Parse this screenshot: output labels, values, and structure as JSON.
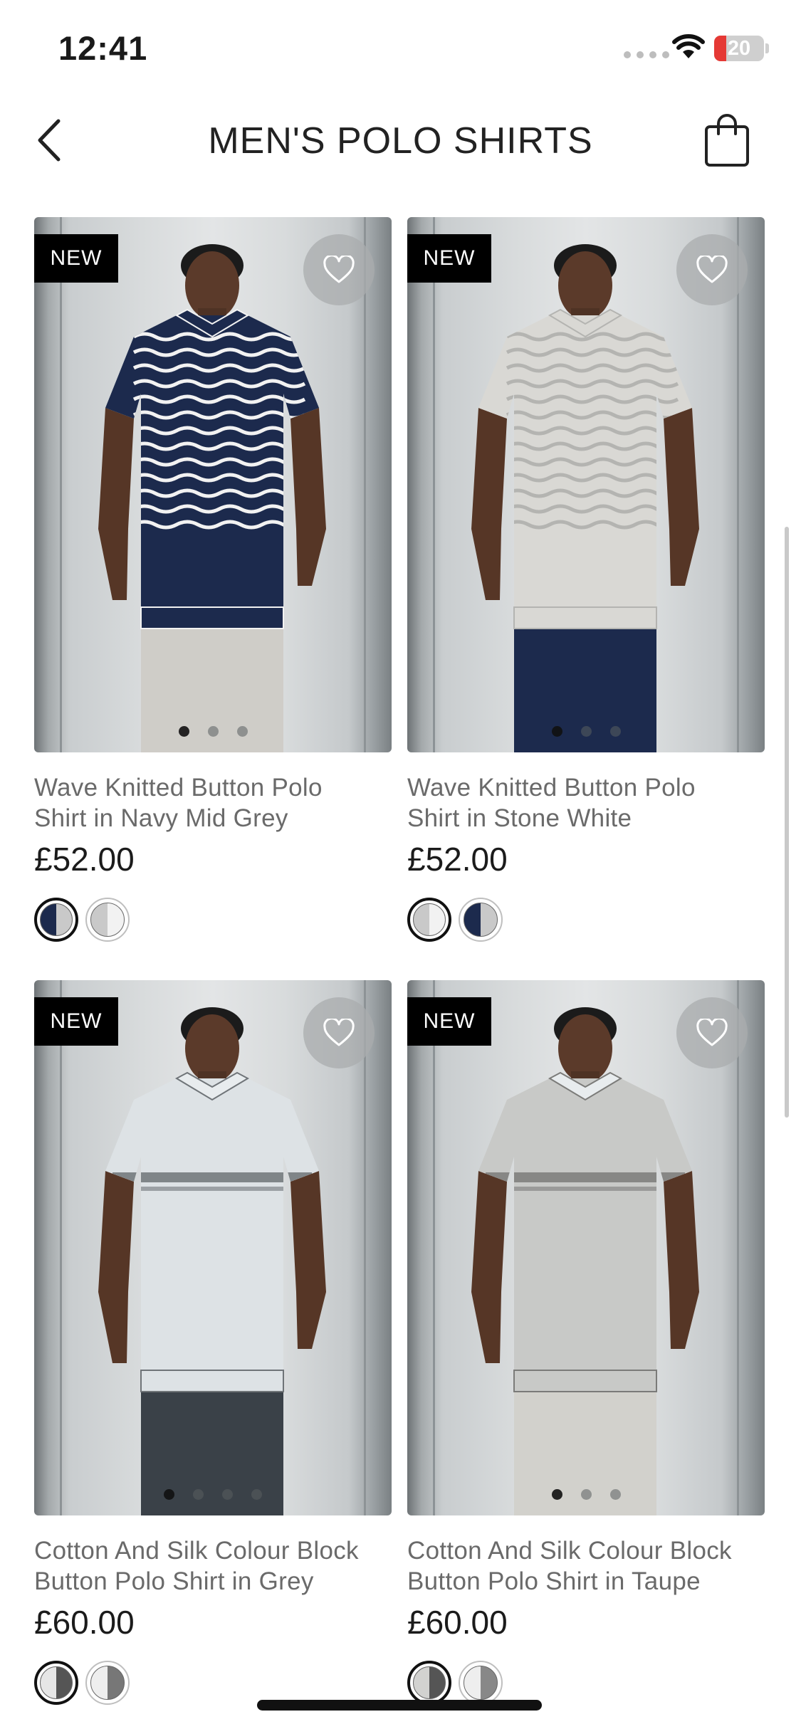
{
  "status_bar": {
    "time": "12:41",
    "battery": "20"
  },
  "header": {
    "title": "MEN'S POLO SHIRTS"
  },
  "products": [
    {
      "badge": "NEW",
      "name_line1": "Wave Knitted Button Polo",
      "name_line2": "Shirt in Navy Mid Grey",
      "price": "£52.00",
      "shirt_color": "#1c2a4d",
      "stripe_color": "#f2f2f2",
      "pants_color": "#cfcdc8",
      "image_dots": 3,
      "active_dot": 0,
      "swatches": [
        {
          "colors": [
            "#1c2a4d",
            "#c9c9c9"
          ],
          "selected": true
        },
        {
          "colors": [
            "#c9c9c9",
            "#f2f2f2"
          ],
          "selected": false
        }
      ]
    },
    {
      "badge": "NEW",
      "name_line1": "Wave Knitted Button Polo",
      "name_line2": "Shirt in Stone White",
      "price": "£52.00",
      "shirt_color": "#d9d8d4",
      "stripe_color": "#b4b4b1",
      "pants_color": "#1c2a4d",
      "image_dots": 3,
      "active_dot": 0,
      "swatches": [
        {
          "colors": [
            "#c9c9c9",
            "#f2f2f2"
          ],
          "selected": true
        },
        {
          "colors": [
            "#1c2a4d",
            "#c9c9c9"
          ],
          "selected": false
        }
      ]
    },
    {
      "badge": "NEW",
      "name_line1": "Cotton And Silk Colour Block",
      "name_line2": "Button Polo Shirt in Grey",
      "price": "£60.00",
      "shirt_color": "#dde2e5",
      "stripe_color": "#6f7478",
      "pants_color": "#3a4148",
      "image_dots": 4,
      "active_dot": 0,
      "swatches": [
        {
          "colors": [
            "#e6e6e6",
            "#555555"
          ],
          "selected": true
        },
        {
          "colors": [
            "#eeeeee",
            "#777777"
          ],
          "selected": false
        }
      ]
    },
    {
      "badge": "NEW",
      "name_line1": "Cotton And Silk Colour Block",
      "name_line2": "Button Polo Shirt in Taupe",
      "price": "£60.00",
      "shirt_color": "#c8c9c7",
      "stripe_color": "#7b7b79",
      "pants_color": "#d2d1cc",
      "image_dots": 3,
      "active_dot": 0,
      "swatches": [
        {
          "colors": [
            "#d2d2d0",
            "#555555"
          ],
          "selected": true
        },
        {
          "colors": [
            "#eeeeee",
            "#888888"
          ],
          "selected": false
        }
      ]
    }
  ]
}
